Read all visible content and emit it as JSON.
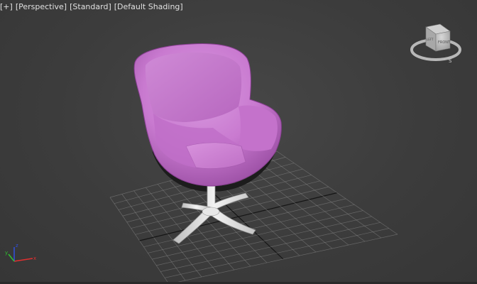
{
  "viewport_label": {
    "plus": "[+]",
    "view": "[Perspective]",
    "mode": "[Standard]",
    "shading": "[Default Shading]"
  },
  "viewcube": {
    "face_front": "FRONT",
    "face_left": "LEFT",
    "compass_south": "S"
  },
  "axis_tripod": {
    "x": "x",
    "y": "y",
    "z": "z"
  },
  "colors": {
    "background": "#3d3d3d",
    "chair_shell": "#c97ad0",
    "chair_base": "#e6e6e6",
    "grid": "#8a8a8a",
    "axis_x": "#e03030",
    "axis_y": "#30c030",
    "axis_z": "#3050e0"
  }
}
